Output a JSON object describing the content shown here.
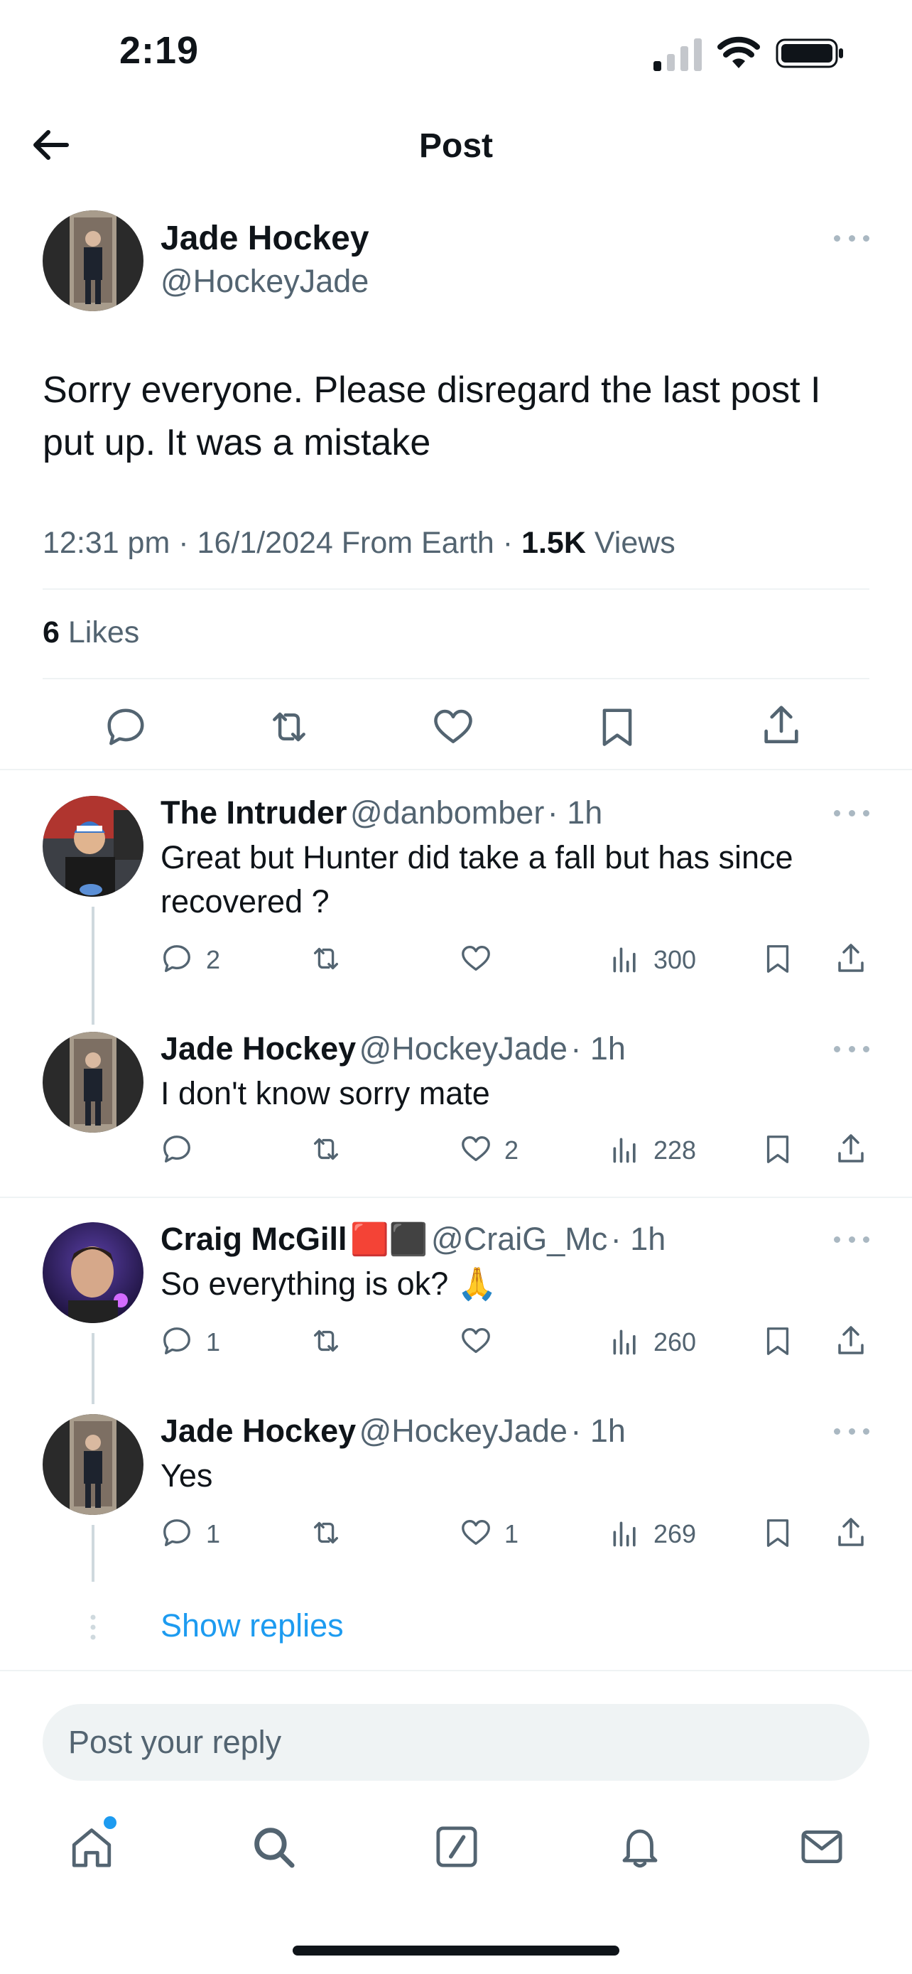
{
  "status_bar": {
    "time": "2:19"
  },
  "header": {
    "title": "Post",
    "back_icon": "arrow-left-icon"
  },
  "post": {
    "author_name": "Jade Hockey",
    "author_handle": "@HockeyJade",
    "text_line1": "Sorry everyone. Please disregard the last post I",
    "text_line2": "put up. It was a mistake",
    "time": "12:31 pm",
    "date_source": "16/1/2024 From Earth",
    "views_count": "1.5K",
    "views_label": "Views",
    "likes_count": "6",
    "likes_label": "Likes",
    "actions": [
      "reply-icon",
      "repost-icon",
      "like-icon",
      "bookmark-icon",
      "share-icon"
    ]
  },
  "replies": [
    {
      "name": "The Intruder",
      "handle": "@danbomber",
      "time": "· 1h",
      "text_line1": "Great but Hunter did take a fall but has since",
      "text_line2": "recovered ?",
      "replies": "2",
      "reposts": "",
      "likes": "",
      "views": "300"
    },
    {
      "name": "Jade Hockey",
      "handle": "@HockeyJade",
      "time": "· 1h",
      "text_line1": "I don't know sorry mate",
      "replies": "",
      "reposts": "",
      "likes": "2",
      "views": "228"
    },
    {
      "name": "Craig McGill",
      "name_flags": "🟥⬛",
      "handle": "@CraiG_Mc",
      "time": "· 1h",
      "text_line1": "So everything is ok? 🙏",
      "replies": "1",
      "reposts": "",
      "likes": "",
      "views": "260"
    },
    {
      "name": "Jade Hockey",
      "handle": "@HockeyJade",
      "time": "· 1h",
      "text_line1": "Yes",
      "replies": "1",
      "reposts": "",
      "likes": "1",
      "views": "269"
    }
  ],
  "show_replies": "Show replies",
  "reply_box": {
    "placeholder": "Post your reply"
  },
  "tab_bar": [
    "home-icon",
    "search-icon",
    "compose-icon",
    "notifications-icon",
    "messages-icon"
  ],
  "colors": {
    "link": "#1d9bf0",
    "muted": "#536471",
    "text": "#0f1419",
    "divider": "#eff3f4"
  }
}
